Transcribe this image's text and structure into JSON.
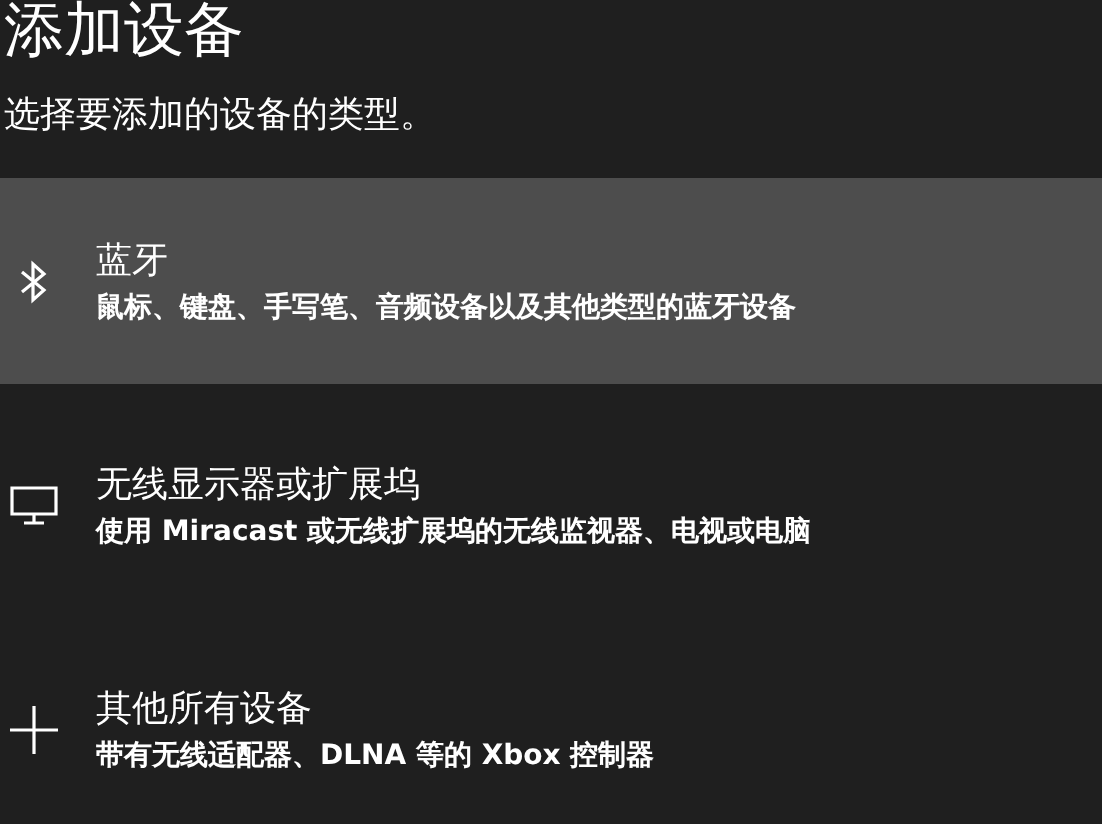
{
  "title": "添加设备",
  "subtitle": "选择要添加的设备的类型。",
  "devices": [
    {
      "kind": "bluetooth",
      "name": "蓝牙",
      "description": "鼠标、键盘、手写笔、音频设备以及其他类型的蓝牙设备",
      "selected": true
    },
    {
      "kind": "display",
      "name": "无线显示器或扩展坞",
      "description": "使用 Miracast 或无线扩展坞的无线监视器、电视或电脑",
      "selected": false
    },
    {
      "kind": "other",
      "name": "其他所有设备",
      "description": "带有无线适配器、DLNA 等的 Xbox 控制器",
      "selected": false
    }
  ]
}
